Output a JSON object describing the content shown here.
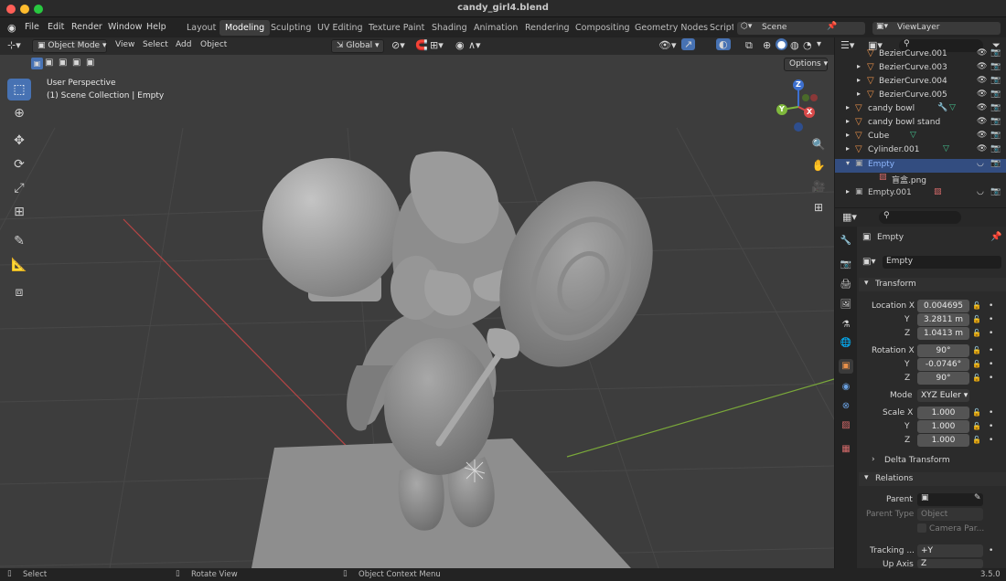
{
  "window": {
    "title": "candy_girl4.blend"
  },
  "menu": [
    "File",
    "Edit",
    "Render",
    "Window",
    "Help"
  ],
  "workspaces": [
    "Layout",
    "Modeling",
    "Sculpting",
    "UV Editing",
    "Texture Paint",
    "Shading",
    "Animation",
    "Rendering",
    "Compositing",
    "Geometry Nodes",
    "Scripti"
  ],
  "scene": "Scene",
  "view_layer": "ViewLayer",
  "viewport_header": {
    "mode": "Object Mode",
    "menus": [
      "View",
      "Select",
      "Add",
      "Object"
    ],
    "orientation": "Global",
    "options": "Options"
  },
  "viewport": {
    "label_line1": "User Perspective",
    "label_line2": "(1) Scene Collection | Empty",
    "gizmo_axes": [
      "Z",
      "Y",
      "X"
    ]
  },
  "outliner": {
    "rows": [
      {
        "label": "BezierCurve.001",
        "type": "curve"
      },
      {
        "label": "BezierCurve.003",
        "type": "curve"
      },
      {
        "label": "BezierCurve.004",
        "type": "curve"
      },
      {
        "label": "BezierCurve.005",
        "type": "curve"
      },
      {
        "label": "candy bowl",
        "type": "mesh"
      },
      {
        "label": "candy bowl stand",
        "type": "mesh"
      },
      {
        "label": "Cube",
        "type": "mesh"
      },
      {
        "label": "Cylinder.001",
        "type": "mesh"
      },
      {
        "label": "Empty",
        "type": "empty",
        "selected": true
      },
      {
        "label": "盲盒.png",
        "type": "image"
      },
      {
        "label": "Empty.001",
        "type": "empty"
      }
    ]
  },
  "properties": {
    "object_name": "Empty",
    "datablock_name": "Empty",
    "transform_title": "Transform",
    "location_label": "Location X",
    "location": [
      "0.004695",
      "3.2811 m",
      "1.0413 m"
    ],
    "rotation_label": "Rotation X",
    "rotation": [
      "90°",
      "-0.0746°",
      "90°"
    ],
    "mode_label": "Mode",
    "mode_value": "XYZ Euler",
    "scale_label": "Scale X",
    "scale": [
      "1.000",
      "1.000",
      "1.000"
    ],
    "axis_y": "Y",
    "axis_z": "Z",
    "delta_transform": "Delta Transform",
    "relations_title": "Relations",
    "parent_label": "Parent",
    "parent_type_label": "Parent Type",
    "parent_type_value": "Object",
    "camera_parent_label": "Camera Par...",
    "tracking_label": "Tracking ...",
    "tracking_value": "+Y",
    "up_axis_label": "Up Axis",
    "up_axis_value": "Z"
  },
  "statusbar": {
    "select": "Select",
    "rotate": "Rotate View",
    "context": "Object Context Menu",
    "version": "3.5.0"
  },
  "colors": {
    "accent": "#4772b3",
    "background": "#3d3d3d",
    "model": "#a8a8a8",
    "axis_x": "#d94a4a",
    "axis_y": "#7fb83c",
    "axis_z": "#3d70d0"
  }
}
